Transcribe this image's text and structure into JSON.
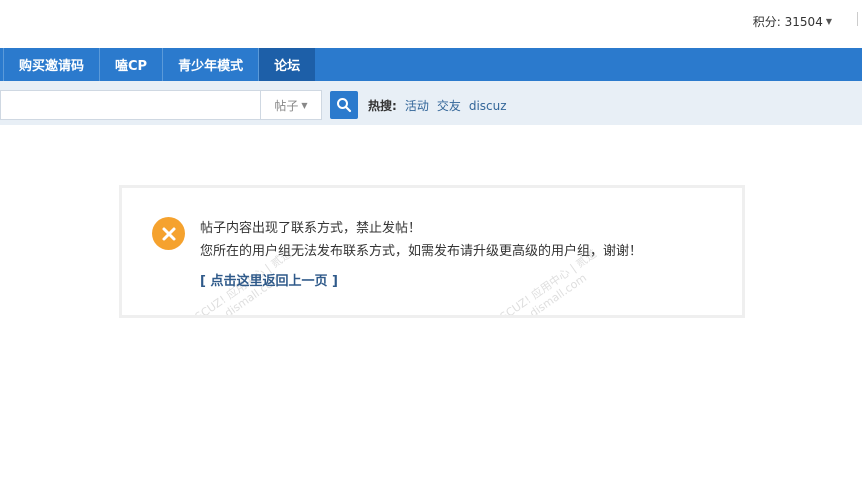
{
  "topbar": {
    "credits_label": "积分: 31504"
  },
  "nav": {
    "items": [
      {
        "label": "购买邀请码",
        "active": false
      },
      {
        "label": "嗑CP",
        "active": false
      },
      {
        "label": "青少年模式",
        "active": false
      },
      {
        "label": "论坛",
        "active": true
      }
    ]
  },
  "search": {
    "placeholder": "",
    "type_label": "帖子",
    "hot_label": "热搜:",
    "hot_links": [
      "活动",
      "交友",
      "discuz"
    ]
  },
  "message": {
    "line1": "帖子内容出现了联系方式，禁止发帖！",
    "line2": "您所在的用户组无法发布联系方式，如需发布请升级更高级的用户组，谢谢！",
    "back_link": "[ 点击这里返回上一页 ]"
  },
  "colors": {
    "nav_bg": "#2b7acd",
    "nav_active": "#1d5fa8",
    "search_bar_bg": "#e8eff6",
    "icon_bg": "#f5a22e",
    "link": "#336699"
  },
  "watermark": {
    "lines": [
      "DISCUZ! 应用中心 | 贰道",
      "addon.dismall.com"
    ]
  }
}
